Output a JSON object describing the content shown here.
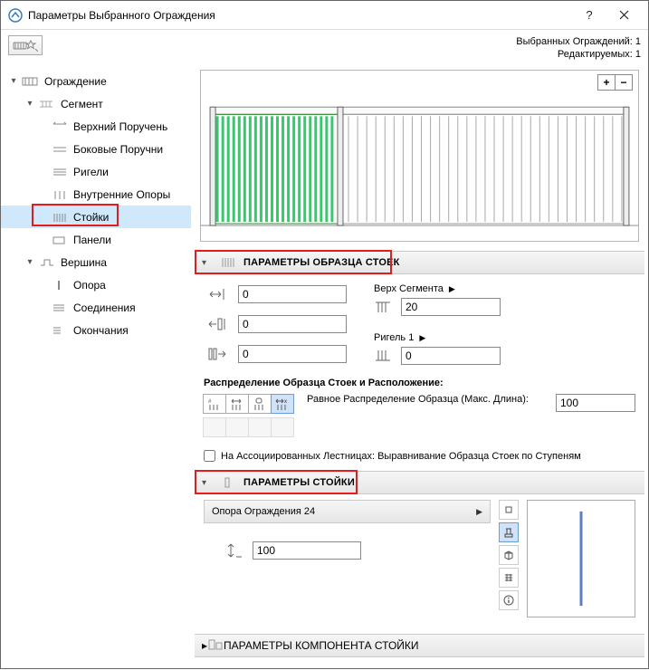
{
  "titlebar": {
    "title": "Параметры Выбранного Ограждения"
  },
  "info": {
    "selected_label": "Выбранных Ограждений:",
    "selected_count": "1",
    "editable_label": "Редактируемых:",
    "editable_count": "1"
  },
  "tree": {
    "root": "Ограждение",
    "segment": "Сегмент",
    "items": [
      {
        "label": "Верхний Поручень"
      },
      {
        "label": "Боковые Поручни"
      },
      {
        "label": "Ригели"
      },
      {
        "label": "Внутренние Опоры"
      },
      {
        "label": "Стойки"
      },
      {
        "label": "Панели"
      }
    ],
    "top": "Вершина",
    "top_items": [
      {
        "label": "Опора"
      },
      {
        "label": "Соединения"
      },
      {
        "label": "Окончания"
      }
    ]
  },
  "panels": {
    "sample": {
      "title": "ПАРАМЕТРЫ ОБРАЗЦА СТОЕК",
      "offset_top": "0",
      "offset_side": "0",
      "offset_bottom": "0",
      "ref_top_label": "Верх Сегмента",
      "ref_top_value": "20",
      "ref_side_label": "Ригель 1",
      "ref_side_value": "0",
      "dist_label": "Распределение Образца Стоек и Расположение:",
      "dist_desc": "Равное Распределение Образца (Макс. Длина):",
      "dist_value": "100",
      "stairs_chk": "На Ассоциированных Лестницах: Выравнивание Образца Стоек по Ступеням"
    },
    "baluster": {
      "title": "ПАРАМЕТРЫ СТОЙКИ",
      "profile": "Опора Ограждения 24",
      "height": "100"
    },
    "component": {
      "title": "ПАРАМЕТРЫ КОМПОНЕНТА СТОЙКИ"
    }
  }
}
